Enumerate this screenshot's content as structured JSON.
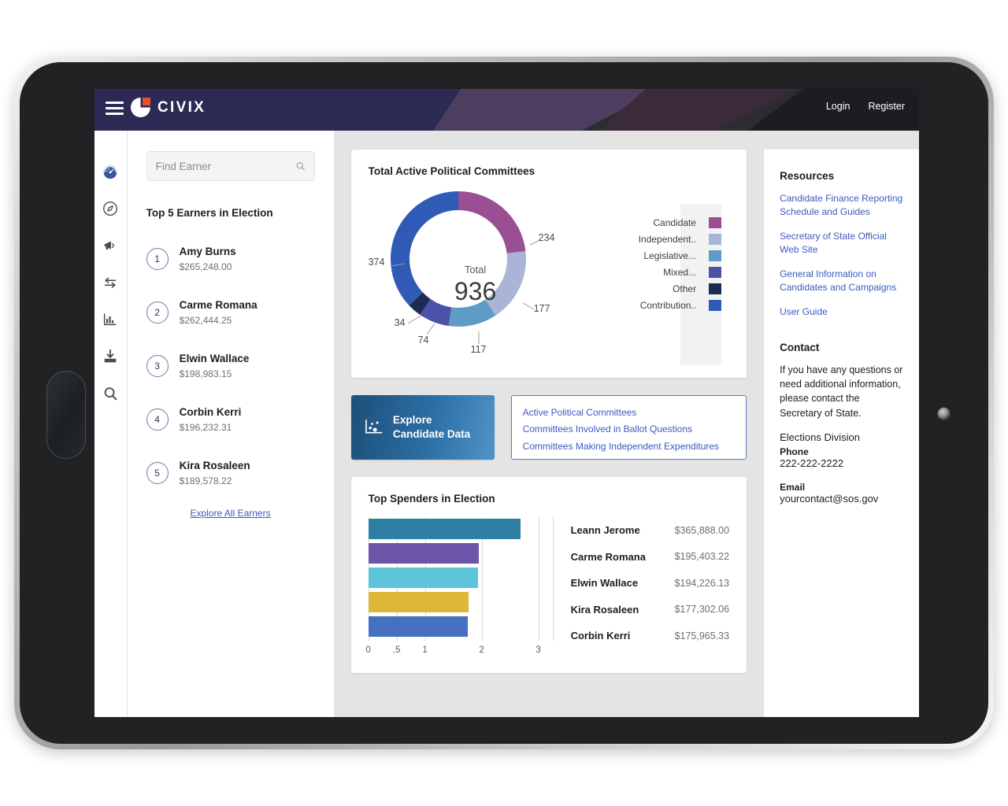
{
  "header": {
    "brand": "CIVIX",
    "menu_icon": "hamburger-icon",
    "login_label": "Login",
    "register_label": "Register"
  },
  "sidebar_rail": {
    "items": [
      {
        "icon": "dashboard-gauge-icon",
        "active": true
      },
      {
        "icon": "compass-icon",
        "active": false
      },
      {
        "icon": "megaphone-icon",
        "active": false
      },
      {
        "icon": "transfer-arrows-icon",
        "active": false
      },
      {
        "icon": "bar-chart-icon",
        "active": false
      },
      {
        "icon": "download-icon",
        "active": false
      },
      {
        "icon": "search-icon",
        "active": false
      }
    ]
  },
  "left_panel": {
    "search": {
      "placeholder": "Find Earner",
      "value": "",
      "icon": "search-icon"
    },
    "earners_title": "Top 5 Earners in Election",
    "earners": [
      {
        "rank": "1",
        "name": "Amy Burns",
        "amount": "$265,248.00"
      },
      {
        "rank": "2",
        "name": "Carme Romana",
        "amount": "$262,444.25"
      },
      {
        "rank": "3",
        "name": "Elwin Wallace",
        "amount": "$198,983.15"
      },
      {
        "rank": "4",
        "name": "Corbin Kerri",
        "amount": "$196,232.31"
      },
      {
        "rank": "5",
        "name": "Kira Rosaleen",
        "amount": "$189,578.22"
      }
    ],
    "explore_all_label": "Explore All Earners"
  },
  "explore_cta": {
    "label": "Explore Candidate Data",
    "icon": "scatter-plot-icon"
  },
  "quick_links": [
    "Active Political Committees",
    "Committees Involved in Ballot Questions",
    "Committees Making Independent Expenditures"
  ],
  "right_panel": {
    "resources_title": "Resources",
    "resource_links": [
      "Candidate Finance Reporting Schedule and Guides",
      "Secretary of State Official Web Site",
      "General Information on Candidates and Campaigns",
      "User Guide"
    ],
    "contact_title": "Contact",
    "contact_intro": "If you have any questions or need additional information, please contact the Secretary of State.",
    "division": "Elections Division",
    "phone_label": "Phone",
    "phone": "222-222-2222",
    "email_label": "Email",
    "email": "yourcontact@sos.gov"
  },
  "chart_data": [
    {
      "type": "pie",
      "title": "Total Active Political Committees",
      "center_label": "Total",
      "center_value": "936",
      "total": 936,
      "legend_position": "right",
      "categories": [
        "Candidate",
        "Independent..",
        "Legislative...",
        "Mixed...",
        "Other",
        "Contribution.."
      ],
      "values": [
        234,
        177,
        117,
        74,
        34,
        374
      ],
      "colors": [
        "#9a4f95",
        "#a9b4d6",
        "#5e9cc6",
        "#4a53a8",
        "#1f2a55",
        "#2f5bb7"
      ],
      "labels": [
        "234",
        "177",
        "117",
        "74",
        "34",
        "374"
      ]
    },
    {
      "type": "bar",
      "title": "Top Spenders in Election",
      "orientation": "horizontal",
      "categories": [
        "Leann Jerome",
        "Carme Romana",
        "Elwin Wallace",
        "Kira Rosaleen",
        "Corbin Kerri"
      ],
      "values": [
        2.68,
        1.95,
        1.94,
        1.77,
        1.76
      ],
      "amounts": [
        "$365,888.00",
        "$195,403.22",
        "$194,226.13",
        "$177,302.06",
        "$175,965.33"
      ],
      "colors": [
        "#2e7fa4",
        "#6a55a8",
        "#5ec4da",
        "#ddb738",
        "#4571c0"
      ],
      "xticks": [
        "0",
        ".5",
        "1",
        "2",
        "3"
      ],
      "xlim": [
        0,
        3
      ],
      "xlabel": "",
      "ylabel": "",
      "grid": true
    }
  ]
}
